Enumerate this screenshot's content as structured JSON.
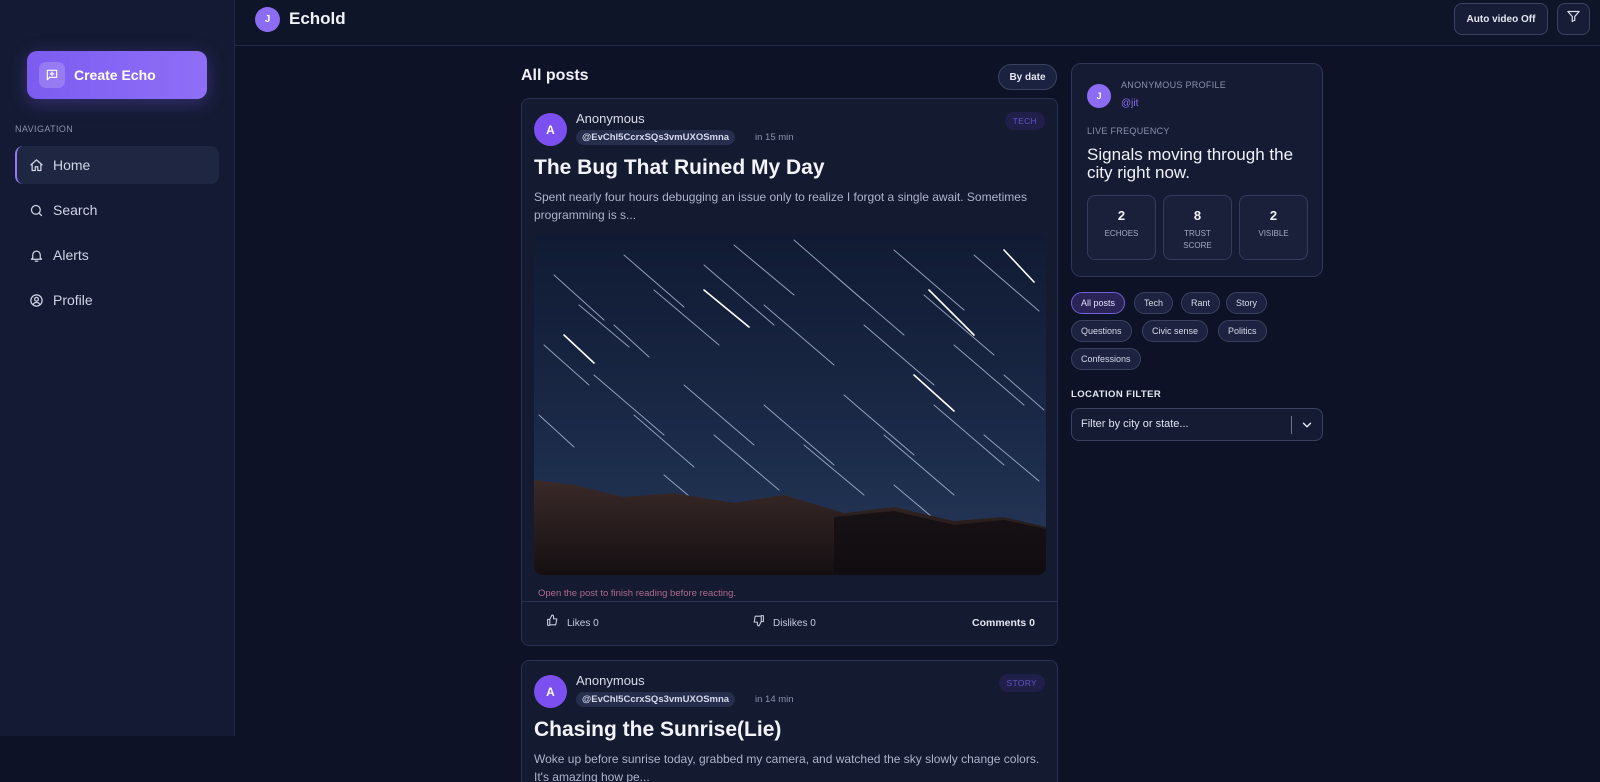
{
  "app": {
    "name": "Echold",
    "avatar_letter": "J"
  },
  "sidebar": {
    "create_label": "Create Echo",
    "nav_heading": "NAVIGATION",
    "items": [
      {
        "label": "Home",
        "icon": "home-icon",
        "active": true
      },
      {
        "label": "Search",
        "icon": "search-icon"
      },
      {
        "label": "Alerts",
        "icon": "bell-icon"
      },
      {
        "label": "Profile",
        "icon": "user-circle-icon"
      }
    ]
  },
  "topbar": {
    "auto_video_label": "Auto video Off",
    "filter_icon": "filter-icon"
  },
  "feed": {
    "title": "All posts",
    "sort_label": "By date",
    "posts": [
      {
        "avatar_letter": "A",
        "author": "Anonymous",
        "handle": "@EvChl5CcrxSQs3vmUXOSmna",
        "time": "in 15 min",
        "tag": "TECH",
        "title": "The Bug That Ruined My Day",
        "body": "Spent nearly four hours debugging an issue only to realize I forgot a single await. Sometimes programming is s...",
        "note": "Open the post to finish reading before reacting.",
        "likes_label": "Likes 0",
        "dislikes_label": "Dislikes 0",
        "comments_label": "Comments 0"
      },
      {
        "avatar_letter": "A",
        "author": "Anonymous",
        "handle": "@EvChl5CcrxSQs3vmUXOSmna",
        "time": "in 14 min",
        "tag": "STORY",
        "title": "Chasing the Sunrise(Lie)",
        "body": "Woke up before sunrise today, grabbed my camera, and watched the sky slowly change colors. It's amazing how pe..."
      }
    ]
  },
  "profile_card": {
    "avatar_letter": "J",
    "label": "ANONYMOUS PROFILE",
    "handle": "@jit",
    "live_label": "LIVE FREQUENCY",
    "headline": "Signals moving through the city right now.",
    "stats": [
      {
        "value": "2",
        "label": "ECHOES"
      },
      {
        "value": "8",
        "label": "TRUST SCORE"
      },
      {
        "value": "2",
        "label": "VISIBLE"
      }
    ]
  },
  "chips": [
    "All posts",
    "Tech",
    "Rant",
    "Story",
    "Questions",
    "Civic sense",
    "Politics",
    "Confessions"
  ],
  "location": {
    "label": "LOCATION FILTER",
    "placeholder": "Filter by city or state..."
  },
  "colors": {
    "accent": "#8b6cf2",
    "background": "#0d1226",
    "panel": "#141a33"
  }
}
